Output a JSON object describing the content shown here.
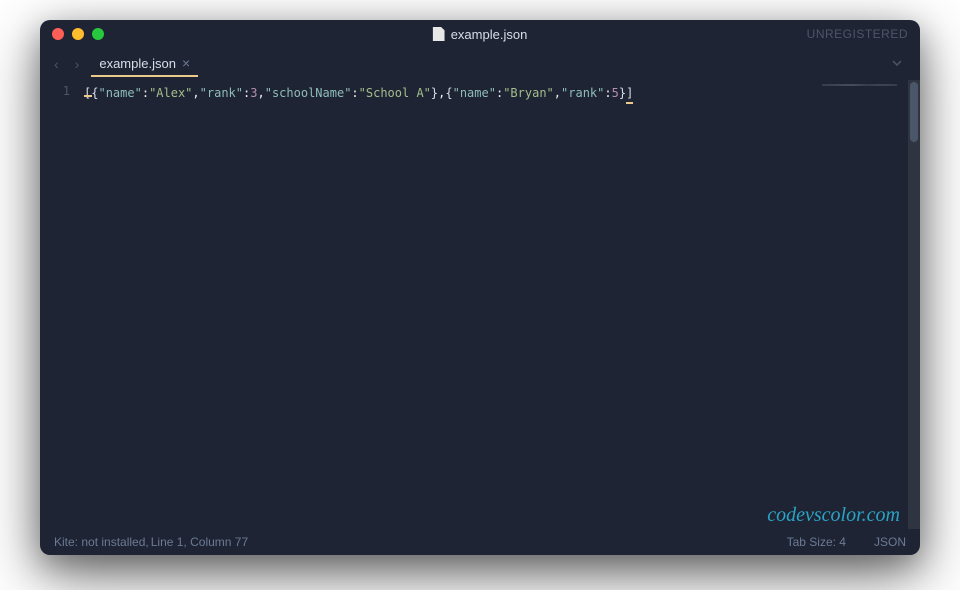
{
  "titlebar": {
    "filename": "example.json",
    "registration": "UNREGISTERED"
  },
  "tabs": {
    "active": "example.json"
  },
  "editor": {
    "line_number": "1",
    "tokens": [
      {
        "class": "tok-bracket",
        "text": "["
      },
      {
        "class": "tok-brace",
        "text": "{"
      },
      {
        "class": "tok-key",
        "text": "\"name\""
      },
      {
        "class": "tok-punct",
        "text": ":"
      },
      {
        "class": "tok-string",
        "text": "\"Alex\""
      },
      {
        "class": "tok-punct",
        "text": ","
      },
      {
        "class": "tok-key",
        "text": "\"rank\""
      },
      {
        "class": "tok-punct",
        "text": ":"
      },
      {
        "class": "tok-number",
        "text": "3"
      },
      {
        "class": "tok-punct",
        "text": ","
      },
      {
        "class": "tok-key",
        "text": "\"schoolName\""
      },
      {
        "class": "tok-punct",
        "text": ":"
      },
      {
        "class": "tok-string",
        "text": "\"School A\""
      },
      {
        "class": "tok-brace",
        "text": "}"
      },
      {
        "class": "tok-punct",
        "text": ","
      },
      {
        "class": "tok-brace",
        "text": "{"
      },
      {
        "class": "tok-key",
        "text": "\"name\""
      },
      {
        "class": "tok-punct",
        "text": ":"
      },
      {
        "class": "tok-string",
        "text": "\"Bryan\""
      },
      {
        "class": "tok-punct",
        "text": ","
      },
      {
        "class": "tok-key",
        "text": "\"rank\""
      },
      {
        "class": "tok-punct",
        "text": ":"
      },
      {
        "class": "tok-number",
        "text": "5"
      },
      {
        "class": "tok-brace",
        "text": "}"
      },
      {
        "class": "tok-bracket",
        "text": "]"
      }
    ]
  },
  "status": {
    "kite": "Kite: not installed, ",
    "position": "Line 1, Column 77",
    "tab_size": "Tab Size: 4",
    "syntax": "JSON"
  },
  "watermark": "codevscolor.com"
}
